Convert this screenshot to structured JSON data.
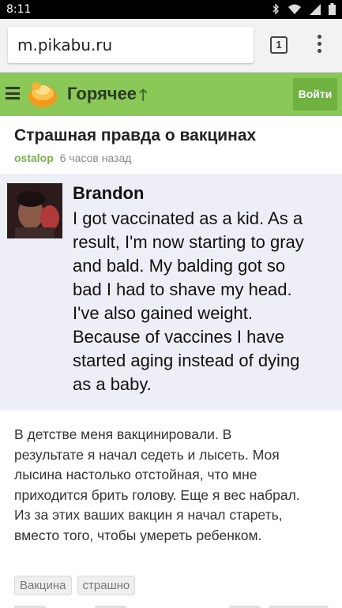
{
  "statusbar": {
    "time": "8:11"
  },
  "browser": {
    "url": "m.pikabu.ru",
    "tab_count": "1"
  },
  "header": {
    "section_title": "Горячее",
    "login_label": "Войти"
  },
  "post": {
    "title": "Страшная правда о вакцинах",
    "author": "ostalop",
    "time_ago": "6 часов назад",
    "image": {
      "name": "Brandon",
      "text_lines": [
        "I got vaccinated as a kid. As a",
        "result, I'm now starting to gray",
        "and bald. My balding got so",
        "bad I had to shave my head.",
        "I've also gained weight.",
        "Because of vaccines I have",
        "started aging instead of dying",
        "as a baby."
      ]
    },
    "body_lines": [
      "В детстве меня вакцинировали. В",
      "результате я начал седеть и лысеть. Моя",
      "лысина настолько отстойная, что мне",
      "приходится брить голову. Еще я вес набрал.",
      "Из за этих ваших вакцин я начал стареть,",
      "вместо того, чтобы умереть ребенком."
    ],
    "tags": [
      "Вакцина",
      "страшно"
    ]
  },
  "colors": {
    "header_bg": "#8ac858",
    "login_bg": "#6fb240",
    "author": "#7aad4c",
    "image_bg": "#eeeef6"
  },
  "icons": [
    "bluetooth-icon",
    "wifi-icon",
    "signal-icon",
    "battery-icon",
    "hamburger-icon",
    "pikabu-logo-icon",
    "arrow-up-icon",
    "overflow-menu-icon"
  ]
}
